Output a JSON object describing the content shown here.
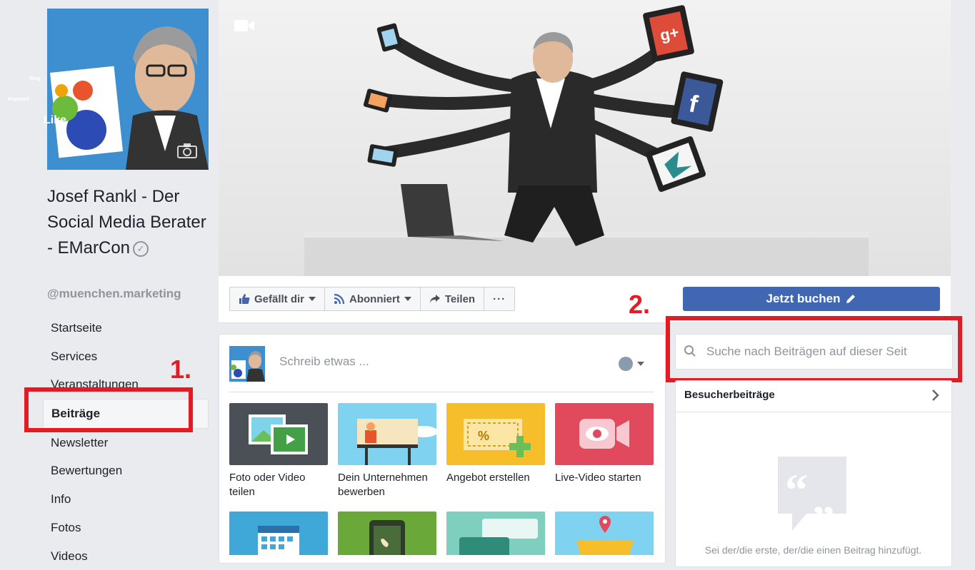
{
  "sidebar": {
    "page_name": "Josef Rankl - Der Social Media Berater - EMarCon",
    "verified_icon": "check-circle-icon",
    "handle": "@muenchen.marketing",
    "nav": [
      {
        "label": "Startseite"
      },
      {
        "label": "Services"
      },
      {
        "label": "Veranstaltungen"
      },
      {
        "label": "Beiträge"
      },
      {
        "label": "Newsletter"
      },
      {
        "label": "Bewertungen"
      },
      {
        "label": "Info"
      },
      {
        "label": "Fotos"
      },
      {
        "label": "Videos"
      }
    ],
    "active_item": "Beiträge"
  },
  "profile_picture": {
    "badges": [
      "Like",
      "Blog",
      "Keyword"
    ]
  },
  "actions": {
    "like_label": "Gefällt dir",
    "follow_label": "Abonniert",
    "share_label": "Teilen",
    "more_label": "···",
    "cta_label": "Jetzt buchen"
  },
  "composer": {
    "placeholder": "Schreib etwas ...",
    "tiles": [
      {
        "label": "Foto oder Video teilen",
        "icon": "photo-video-icon"
      },
      {
        "label": "Dein Unternehmen bewerben",
        "icon": "billboard-icon"
      },
      {
        "label": "Angebot erstellen",
        "icon": "coupon-icon"
      },
      {
        "label": "Live-Video starten",
        "icon": "live-video-icon"
      }
    ],
    "tiles_row2": [
      {
        "icon": "calendar-icon"
      },
      {
        "icon": "phone-call-icon"
      },
      {
        "icon": "chat-bubbles-icon"
      },
      {
        "icon": "location-pin-icon"
      }
    ]
  },
  "right": {
    "search_placeholder": "Suche nach Beiträgen auf dieser Seit",
    "visitor_posts_title": "Besucherbeiträge",
    "visitor_empty_text": "Sei der/die erste, der/die einen Beitrag hinzufügt."
  },
  "annotations": {
    "step1": "1.",
    "step2": "2."
  },
  "colors": {
    "facebook_blue": "#4267b2",
    "annotation_red": "#e41b23",
    "background": "#e9ebee"
  }
}
